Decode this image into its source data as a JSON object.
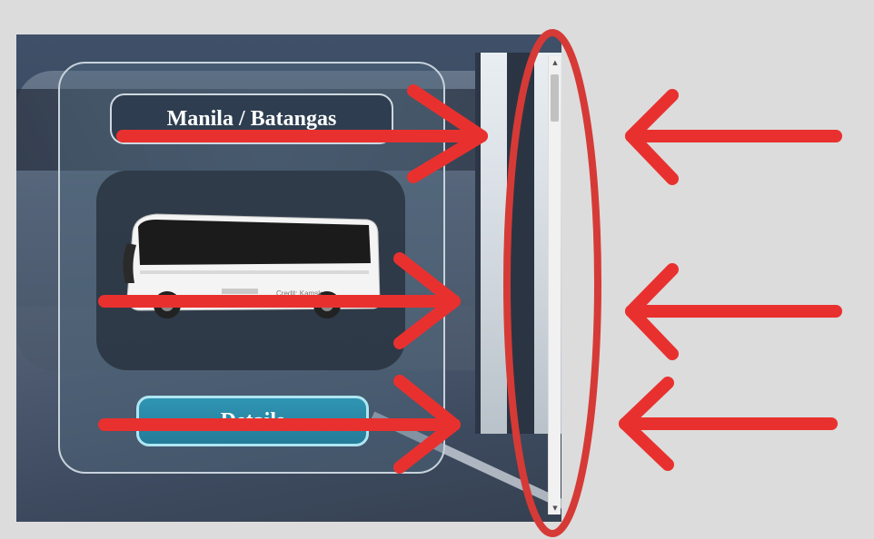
{
  "route_card": {
    "title": "Manila / Batangas",
    "details_label": "Details"
  },
  "bus_image": {
    "watermark": "Credit: Kamsk"
  },
  "scrollbar": {
    "up_icon": "scroll-up-arrow",
    "down_icon": "scroll-down-arrow"
  },
  "annotations": {
    "arrow_color": "#e8312f",
    "ellipse_color": "#d63a36"
  }
}
